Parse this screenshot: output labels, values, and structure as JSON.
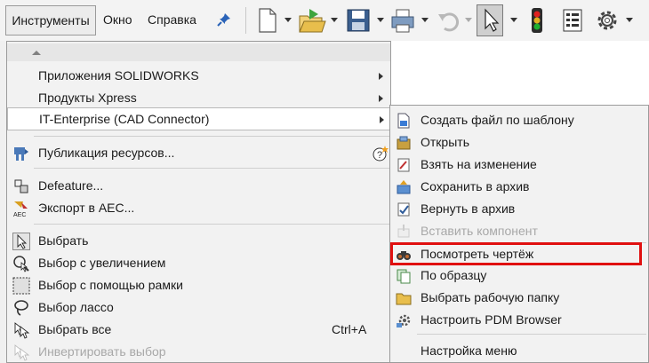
{
  "menubar": {
    "tools": "Инструменты",
    "window": "Окно",
    "help": "Справка"
  },
  "toolbar": {
    "icons": [
      "new-document-icon",
      "open-folder-icon",
      "save-icon",
      "print-icon",
      "undo-icon",
      "select-cursor-icon",
      "traffic-light-icon",
      "options-list-icon",
      "gear-icon"
    ]
  },
  "menu": {
    "items": [
      {
        "label": "Приложения SOLIDWORKS",
        "submenu": true
      },
      {
        "label": "Продукты Xpress",
        "submenu": true
      },
      {
        "label": "IT-Enterprise (CAD Connector)",
        "submenu": true,
        "highlighted": true
      },
      {
        "label": "Публикация ресурсов..."
      },
      {
        "label": "Defeature..."
      },
      {
        "label": "Экспорт в AEC..."
      },
      {
        "label": "Выбрать"
      },
      {
        "label": "Выбор с увеличением"
      },
      {
        "label": "Выбор с помощью рамки"
      },
      {
        "label": "Выбор лассо"
      },
      {
        "label": "Выбрать все",
        "shortcut": "Ctrl+A"
      },
      {
        "label": "Инвертировать выбор",
        "disabled": true
      }
    ]
  },
  "submenu": {
    "items": [
      {
        "label": "Создать файл по шаблону"
      },
      {
        "label": "Открыть"
      },
      {
        "label": "Взять на изменение"
      },
      {
        "label": "Сохранить в архив"
      },
      {
        "label": "Вернуть в архив"
      },
      {
        "label": "Вставить компонент",
        "disabled": true
      },
      {
        "label": "Посмотреть чертёж",
        "boxed": true
      },
      {
        "label": "По образцу"
      },
      {
        "label": "Выбрать рабочую папку"
      },
      {
        "label": "Настроить PDM Browser"
      },
      {
        "label": "Настройка меню"
      }
    ]
  },
  "colors": {
    "highlight_box": "#e01010",
    "menu_bg": "#f2f2f2"
  }
}
